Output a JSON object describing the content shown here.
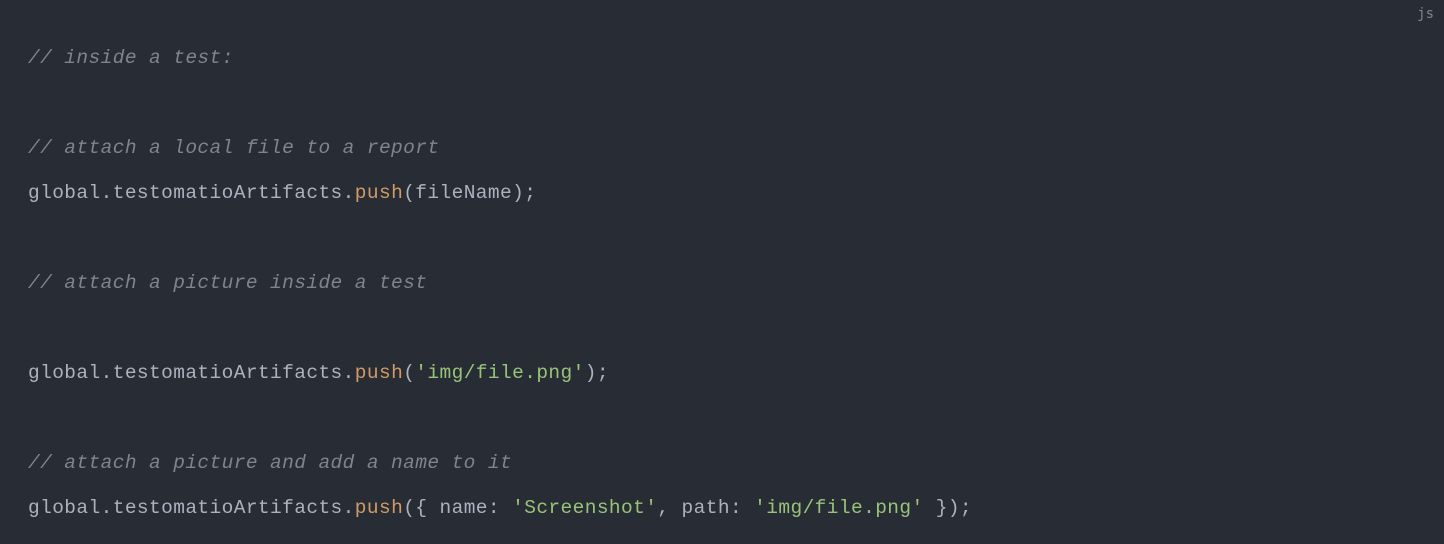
{
  "lang_label": "js",
  "lines": [
    [
      {
        "cls": "tok-comment",
        "text": "// inside a test:"
      }
    ],
    [],
    [
      {
        "cls": "tok-comment",
        "text": "// attach a local file to a report"
      }
    ],
    [
      {
        "cls": "tok-default",
        "text": "global.testomatioArtifacts."
      },
      {
        "cls": "tok-method",
        "text": "push"
      },
      {
        "cls": "tok-default",
        "text": "(fileName);"
      }
    ],
    [],
    [
      {
        "cls": "tok-comment",
        "text": "// attach a picture inside a test"
      }
    ],
    [],
    [
      {
        "cls": "tok-default",
        "text": "global.testomatioArtifacts."
      },
      {
        "cls": "tok-method",
        "text": "push"
      },
      {
        "cls": "tok-default",
        "text": "("
      },
      {
        "cls": "tok-string",
        "text": "'img/file.png'"
      },
      {
        "cls": "tok-default",
        "text": ");"
      }
    ],
    [],
    [
      {
        "cls": "tok-comment",
        "text": "// attach a picture and add a name to it"
      }
    ],
    [
      {
        "cls": "tok-default",
        "text": "global.testomatioArtifacts."
      },
      {
        "cls": "tok-method",
        "text": "push"
      },
      {
        "cls": "tok-default",
        "text": "({ name: "
      },
      {
        "cls": "tok-string",
        "text": "'Screenshot'"
      },
      {
        "cls": "tok-default",
        "text": ", path: "
      },
      {
        "cls": "tok-string",
        "text": "'img/file.png'"
      },
      {
        "cls": "tok-default",
        "text": " });"
      }
    ]
  ]
}
